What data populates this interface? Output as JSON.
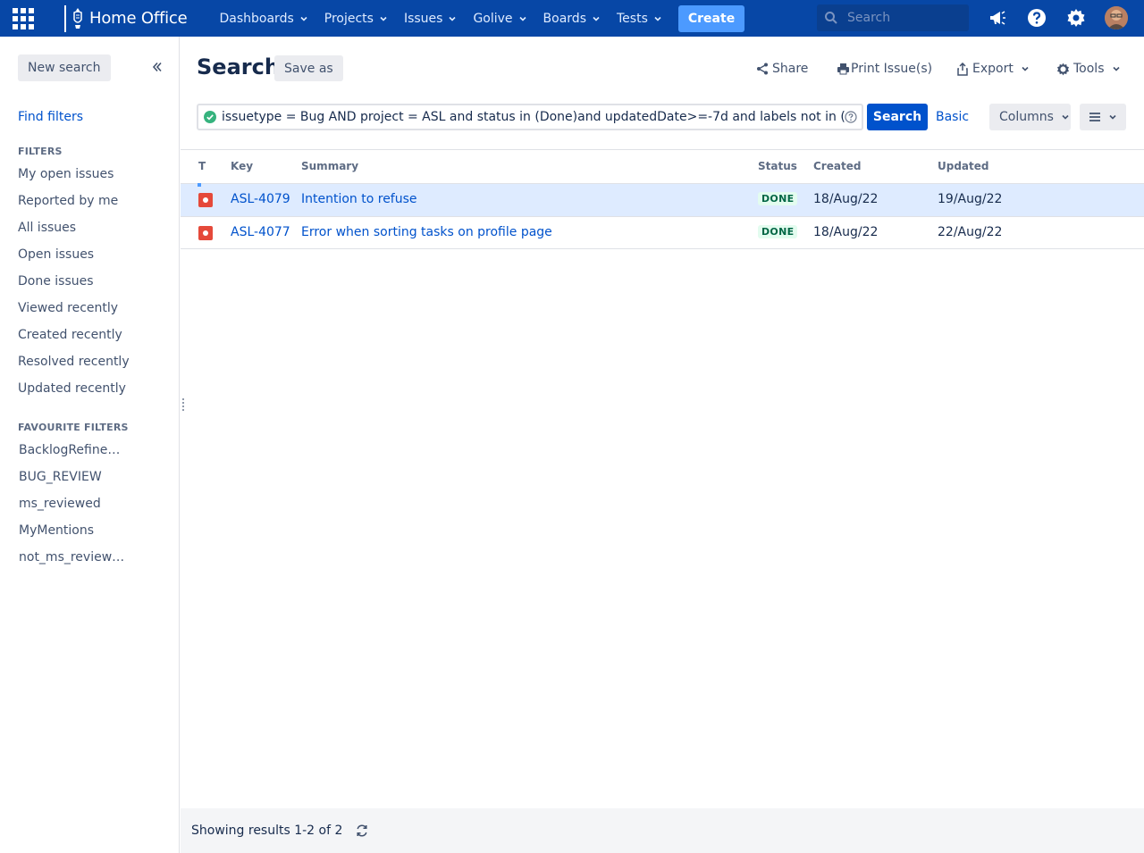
{
  "topnav": {
    "brand": "Home Office",
    "items": [
      {
        "label": "Dashboards"
      },
      {
        "label": "Projects"
      },
      {
        "label": "Issues"
      },
      {
        "label": "Golive"
      },
      {
        "label": "Boards"
      },
      {
        "label": "Tests"
      }
    ],
    "create_label": "Create",
    "search_placeholder": "Search",
    "colors": {
      "bar": "#0747a6",
      "create": "#4c9aff"
    }
  },
  "sidebar": {
    "new_search_label": "New search",
    "find_filters_label": "Find filters",
    "filters_heading": "FILTERS",
    "filters": [
      "My open issues",
      "Reported by me",
      "All issues",
      "Open issues",
      "Done issues",
      "Viewed recently",
      "Created recently",
      "Resolved recently",
      "Updated recently"
    ],
    "favourites_heading": "FAVOURITE FILTERS",
    "favourites": [
      "BacklogRefineM…",
      "BUG_REVIEW",
      "ms_reviewed",
      "MyMentions",
      "not_ms_reviewed"
    ]
  },
  "header": {
    "title": "Search",
    "save_as_label": "Save as",
    "share_label": "Share",
    "print_label": "Print Issue(s)",
    "export_label": "Export",
    "tools_label": "Tools"
  },
  "query": {
    "jql": "issuetype = Bug AND project = ASL and status in (Done)and updatedDate>=-7d and labels not in (wont_fix)",
    "search_label": "Search",
    "basic_label": "Basic",
    "columns_label": "Columns"
  },
  "table": {
    "headers": {
      "type": "T",
      "key": "Key",
      "summary": "Summary",
      "status": "Status",
      "created": "Created",
      "updated": "Updated"
    },
    "rows": [
      {
        "type_icon": "bug-icon",
        "key": "ASL-4079",
        "summary": "Intention to refuse",
        "status": "DONE",
        "created": "18/Aug/22",
        "updated": "19/Aug/22",
        "selected": true
      },
      {
        "type_icon": "bug-icon",
        "key": "ASL-4077",
        "summary": "Error when sorting tasks on profile page",
        "status": "DONE",
        "created": "18/Aug/22",
        "updated": "22/Aug/22",
        "selected": false
      }
    ]
  },
  "footer": {
    "results_text": "Showing results 1-2 of 2"
  }
}
